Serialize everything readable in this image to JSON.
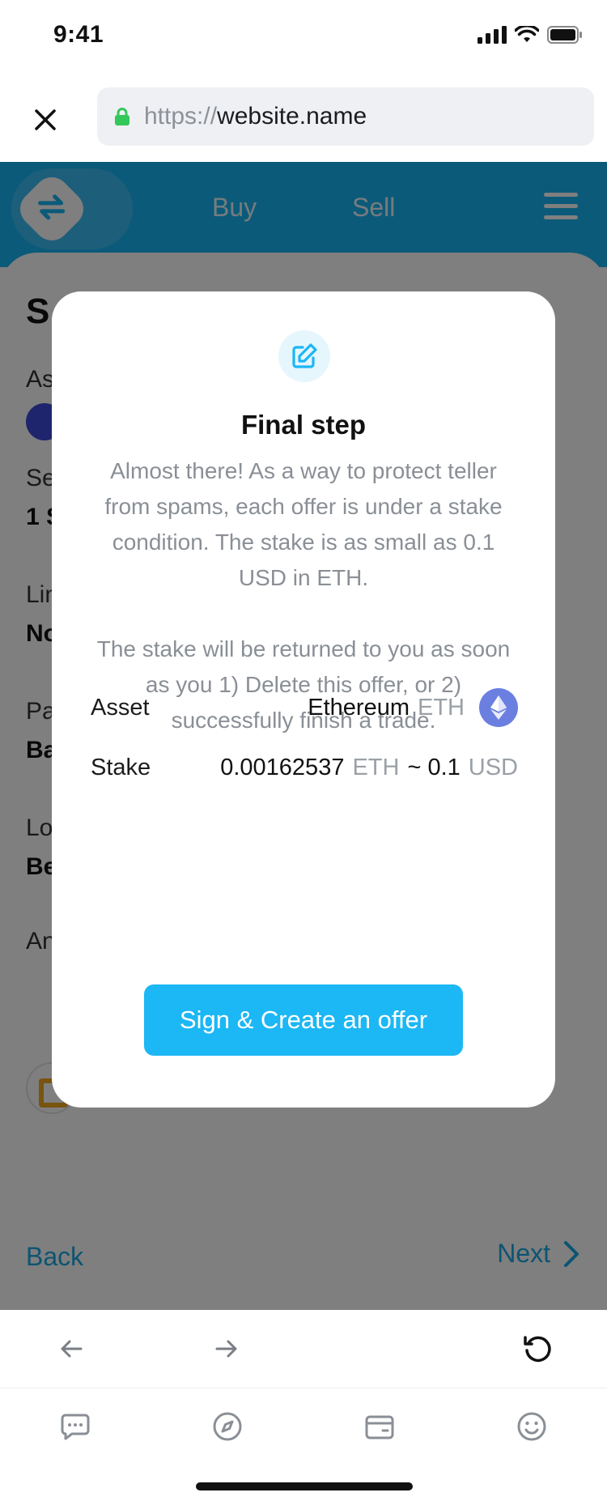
{
  "status_bar": {
    "time": "9:41"
  },
  "browser": {
    "url_scheme": "https://",
    "url_host": "website.name"
  },
  "app": {
    "nav": {
      "buy": "Buy",
      "sell": "Sell"
    }
  },
  "background_page": {
    "title_partial": "S",
    "labels_partial": [
      "As",
      "Se",
      "Lin",
      "Pa",
      "Lo",
      "An"
    ],
    "values_partial": [
      "1 S",
      "No",
      "Ba",
      "Be"
    ],
    "back": "Back",
    "next": "Next"
  },
  "modal": {
    "icon": "edit-icon",
    "title": "Final step",
    "paragraph1": "Almost there! As a way to protect teller from spams, each offer is under a stake condition. The stake is as small as 0.1 USD in ETH.",
    "paragraph2": "The stake will be returned to you as soon as you 1) Delete this offer, or 2) successfully finish a trade.",
    "asset": {
      "label": "Asset",
      "name": "Ethereum",
      "ticker": "ETH",
      "icon": "ethereum-icon"
    },
    "stake": {
      "label": "Stake",
      "amount": "0.00162537",
      "unit": "ETH",
      "approx": "~ 0.1",
      "fiat": "USD"
    },
    "cta": "Sign & Create an offer"
  },
  "colors": {
    "accent": "#1cb7f5",
    "header": "#18b4f2",
    "ethereum": "#6b7fe0",
    "overlay": "rgba(0,0,0,0.5)"
  }
}
